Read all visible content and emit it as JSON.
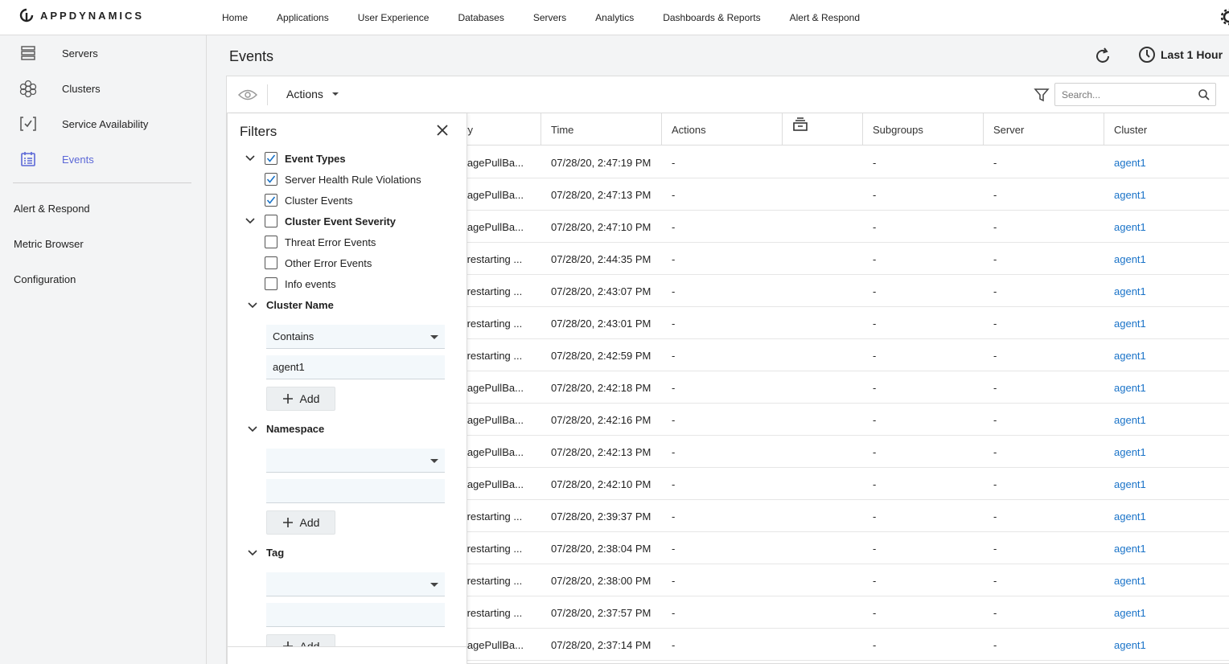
{
  "brand": {
    "name": "APPDYNAMICS"
  },
  "nav": {
    "items": [
      "Home",
      "Applications",
      "User Experience",
      "Databases",
      "Servers",
      "Analytics",
      "Dashboards & Reports",
      "Alert & Respond"
    ]
  },
  "sidebar": {
    "items": [
      {
        "label": "Servers",
        "icon": "servers-icon"
      },
      {
        "label": "Clusters",
        "icon": "clusters-icon"
      },
      {
        "label": "Service Availability",
        "icon": "service-availability-icon"
      },
      {
        "label": "Events",
        "icon": "events-icon",
        "active": true
      }
    ],
    "links": [
      "Alert & Respond",
      "Metric Browser",
      "Configuration"
    ]
  },
  "page": {
    "title": "Events",
    "time_range": "Last 1 Hour"
  },
  "toolbar": {
    "actions_label": "Actions",
    "search_placeholder": "Search..."
  },
  "table": {
    "columns": [
      "ary",
      "Time",
      "Actions",
      "",
      "Subgroups",
      "Server",
      "Cluster"
    ],
    "rows": [
      {
        "summary": "magePullBa...",
        "time": "07/28/20, 2:47:19 PM",
        "actions": "-",
        "subgroups": "-",
        "server": "-",
        "cluster": "agent1"
      },
      {
        "summary": "magePullBa...",
        "time": "07/28/20, 2:47:13 PM",
        "actions": "-",
        "subgroups": "-",
        "server": "-",
        "cluster": "agent1"
      },
      {
        "summary": "magePullBa...",
        "time": "07/28/20, 2:47:10 PM",
        "actions": "-",
        "subgroups": "-",
        "server": "-",
        "cluster": "agent1"
      },
      {
        "summary": "ff restarting ...",
        "time": "07/28/20, 2:44:35 PM",
        "actions": "-",
        "subgroups": "-",
        "server": "-",
        "cluster": "agent1"
      },
      {
        "summary": "ff restarting ...",
        "time": "07/28/20, 2:43:07 PM",
        "actions": "-",
        "subgroups": "-",
        "server": "-",
        "cluster": "agent1"
      },
      {
        "summary": "ff restarting ...",
        "time": "07/28/20, 2:43:01 PM",
        "actions": "-",
        "subgroups": "-",
        "server": "-",
        "cluster": "agent1"
      },
      {
        "summary": "ff restarting ...",
        "time": "07/28/20, 2:42:59 PM",
        "actions": "-",
        "subgroups": "-",
        "server": "-",
        "cluster": "agent1"
      },
      {
        "summary": "magePullBa...",
        "time": "07/28/20, 2:42:18 PM",
        "actions": "-",
        "subgroups": "-",
        "server": "-",
        "cluster": "agent1"
      },
      {
        "summary": "magePullBa...",
        "time": "07/28/20, 2:42:16 PM",
        "actions": "-",
        "subgroups": "-",
        "server": "-",
        "cluster": "agent1"
      },
      {
        "summary": "magePullBa...",
        "time": "07/28/20, 2:42:13 PM",
        "actions": "-",
        "subgroups": "-",
        "server": "-",
        "cluster": "agent1"
      },
      {
        "summary": "magePullBa...",
        "time": "07/28/20, 2:42:10 PM",
        "actions": "-",
        "subgroups": "-",
        "server": "-",
        "cluster": "agent1"
      },
      {
        "summary": "ff restarting ...",
        "time": "07/28/20, 2:39:37 PM",
        "actions": "-",
        "subgroups": "-",
        "server": "-",
        "cluster": "agent1"
      },
      {
        "summary": "ff restarting ...",
        "time": "07/28/20, 2:38:04 PM",
        "actions": "-",
        "subgroups": "-",
        "server": "-",
        "cluster": "agent1"
      },
      {
        "summary": "ff restarting ...",
        "time": "07/28/20, 2:38:00 PM",
        "actions": "-",
        "subgroups": "-",
        "server": "-",
        "cluster": "agent1"
      },
      {
        "summary": "ff restarting ...",
        "time": "07/28/20, 2:37:57 PM",
        "actions": "-",
        "subgroups": "-",
        "server": "-",
        "cluster": "agent1"
      },
      {
        "summary": "magePullBa...",
        "time": "07/28/20, 2:37:14 PM",
        "actions": "-",
        "subgroups": "-",
        "server": "-",
        "cluster": "agent1"
      }
    ]
  },
  "filters": {
    "title": "Filters",
    "event_types": {
      "label": "Event Types",
      "checked": true
    },
    "event_type_items": [
      {
        "label": "Server Health Rule Violations",
        "checked": true
      },
      {
        "label": "Cluster Events",
        "checked": true
      }
    ],
    "severity": {
      "label": "Cluster Event Severity",
      "checked": false
    },
    "severity_items": [
      {
        "label": "Threat Error Events",
        "checked": false
      },
      {
        "label": "Other Error Events",
        "checked": false
      },
      {
        "label": "Info events",
        "checked": false
      }
    ],
    "cluster_name": {
      "label": "Cluster Name",
      "operator": "Contains",
      "value": "agent1",
      "add_label": "Add"
    },
    "namespace": {
      "label": "Namespace",
      "operator": "",
      "value": "",
      "add_label": "Add"
    },
    "tag": {
      "label": "Tag",
      "operator": "",
      "value": "",
      "add_label": "Add"
    }
  },
  "colors": {
    "accent": "#5b67d7",
    "link": "#1a73c8",
    "check": "#1a73c8"
  }
}
